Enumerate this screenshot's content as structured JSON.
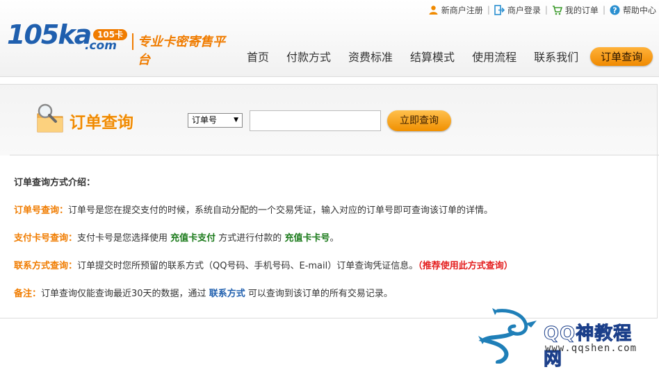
{
  "header": {
    "top_links": [
      {
        "label": "新商户注册",
        "icon": "user-icon"
      },
      {
        "label": "商户登录",
        "icon": "login-icon"
      },
      {
        "label": "我的订单",
        "icon": "cart-icon"
      },
      {
        "label": "帮助中心",
        "icon": "help-icon"
      }
    ],
    "logo": {
      "number": "105",
      "ka": "ka",
      "dotcom": ".com",
      "badge": "105卡",
      "slogan": "专业卡密寄售平台"
    },
    "nav": [
      "首页",
      "付款方式",
      "资费标准",
      "结算模式",
      "使用流程",
      "联系我们"
    ],
    "nav_active": "订单查询"
  },
  "search": {
    "title": "订单查询",
    "select_value": "订单号",
    "input_value": "",
    "button_label": "立即查询"
  },
  "info": {
    "heading": "订单查询方式介绍：",
    "lines": [
      {
        "label": "订单号查询：",
        "text": "订单号是您在提交支付的时候，系统自动分配的一个交易凭证，输入对应的订单号即可查询该订单的详情。"
      },
      {
        "label": "支付卡号查询：",
        "pre": "支付卡号是您选择使用 ",
        "em1": "充值卡支付",
        "mid": " 方式进行付款的 ",
        "em2": "充值卡卡号",
        "post": "。"
      },
      {
        "label": "联系方式查询：",
        "text": "订单提交时您所预留的联系方式（QQ号码、手机号码、E-mail）订单查询凭证信息。",
        "em": "（推荐使用此方式查询）"
      },
      {
        "label": "备注：",
        "pre": "订单查询仅能查询最近30天的数据，通过 ",
        "link": "联系方式",
        "post": " 可以查询到该订单的所有交易记录。"
      }
    ]
  },
  "watermark": {
    "title": "QQ神教程网",
    "url": "www.qqshen.com"
  },
  "colors": {
    "accent": "#f07c00",
    "brand": "#1f5fae",
    "green": "#1a7a1a",
    "red": "#e41e1e"
  }
}
